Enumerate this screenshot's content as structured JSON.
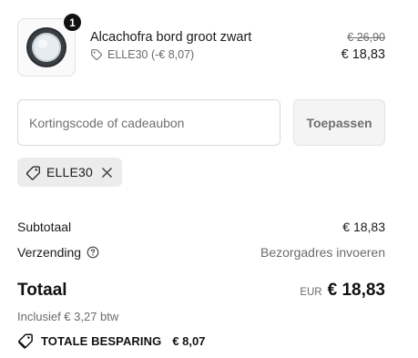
{
  "product": {
    "quantity": "1",
    "name": "Alcachofra bord groot zwart",
    "discount_line": "ELLE30 (-€ 8,07)",
    "icon": "tag-icon",
    "price_original": "€ 26,90",
    "price_current": "€ 18,83"
  },
  "discount": {
    "placeholder": "Kortingscode of cadeaubon",
    "apply_label": "Toepassen",
    "applied_code": "ELLE30"
  },
  "summary": {
    "subtotal_label": "Subtotaal",
    "subtotal_value": "€ 18,83",
    "shipping_label": "Verzending",
    "shipping_value": "Bezorgadres invoeren",
    "total_label": "Totaal",
    "currency_code": "EUR",
    "total_value": "€ 18,83",
    "tax_line": "Inclusief € 3,27 btw",
    "savings_label": "TOTALE BESPARING",
    "savings_value": "€ 8,07"
  },
  "colors": {
    "text": "#1a1a1a",
    "muted": "#6b6b6b",
    "badge": "#111111",
    "button_bg": "#f4f4f4",
    "tag_bg": "#ececec"
  }
}
